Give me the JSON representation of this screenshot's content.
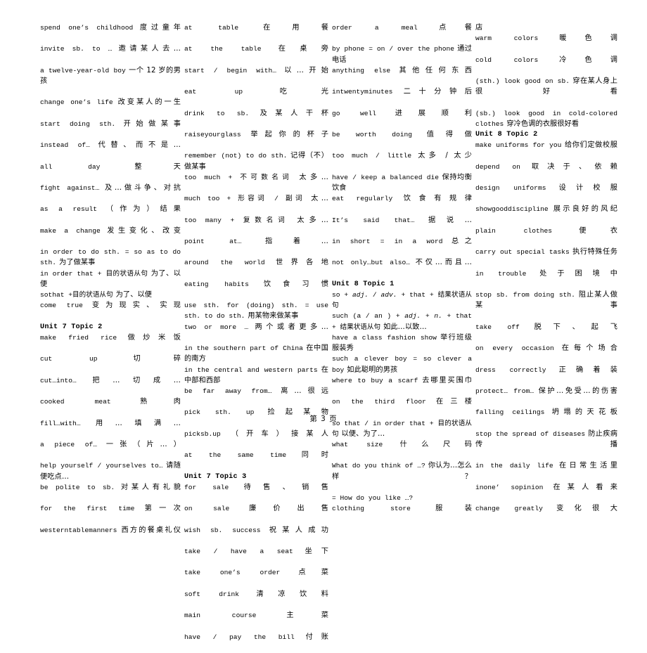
{
  "page": {
    "footer": "第 3 页"
  },
  "columns": [
    {
      "id": "column-1",
      "entries": [
        {
          "type": "pair",
          "en": "spend one’s childhood",
          "zh": "度过童年"
        },
        {
          "type": "pair",
          "en": "invite sb. to …",
          "zh": "邀请某人去…"
        },
        {
          "type": "pair",
          "en": "a twelve-year-old boy",
          "zh": "一个 12 岁的男孩"
        },
        {
          "type": "pair",
          "en": "change one’s life",
          "zh": "改变某人的一生"
        },
        {
          "type": "pair",
          "en": "start doing sth.",
          "zh": "开始做某事"
        },
        {
          "type": "pair",
          "en": "instead of…",
          "zh": "代替、而不是…"
        },
        {
          "type": "pair",
          "en": "all day",
          "zh": "整天"
        },
        {
          "type": "pair",
          "en": "fight against…",
          "zh": "及…做斗争、对抗"
        },
        {
          "type": "pair",
          "en": "as a result",
          "zh": "（作为）结果"
        },
        {
          "type": "pair",
          "en": "make a change",
          "zh": "发生变化、改变"
        },
        {
          "type": "flow",
          "en": "in order to do sth. = so as to do sth.",
          "zh": "为了做某事"
        },
        {
          "type": "flow",
          "en": "in order that + 目的状语从句",
          "zh": "为了、以便"
        },
        {
          "type": "flow",
          "en": "sothat  +目的状语从句",
          "zh": "为了、以便"
        },
        {
          "type": "pair",
          "en": "come true",
          "zh": "变为现实、实现"
        },
        {
          "type": "heading",
          "text": "Unit 7 Topic 2"
        },
        {
          "type": "pair",
          "en": "make fried rice",
          "zh": "做炒米饭"
        },
        {
          "type": "pair",
          "en": "cut up",
          "zh": "切碎"
        },
        {
          "type": "pair",
          "en": "cut…into…",
          "zh": "把…切成…"
        },
        {
          "type": "pair",
          "en": "cooked meat",
          "zh": "熟肉"
        },
        {
          "type": "pair",
          "en": "fill…with…",
          "zh": "用…填满…"
        },
        {
          "type": "pair",
          "en": "a piece of…",
          "zh": "一张（片…）"
        },
        {
          "type": "flow",
          "en": "help yourself / yourselves to…",
          "zh": "请随便吃点…"
        },
        {
          "type": "pair",
          "en": "be polite to sb.",
          "zh": "对某人有礼貌"
        },
        {
          "type": "pair",
          "en": "for the first time",
          "zh": "第一次"
        },
        {
          "type": "pair",
          "en": "westerntablemanners",
          "zh": "西方的餐桌礼仪"
        }
      ]
    },
    {
      "id": "column-2",
      "entries": [
        {
          "type": "pair",
          "en": "at table",
          "zh": "在用餐"
        },
        {
          "type": "pair",
          "en": "at the table",
          "zh": "在桌旁"
        },
        {
          "type": "pair",
          "en": "start / begin with…",
          "zh": "以…开始"
        },
        {
          "type": "pair",
          "en": "eat up",
          "zh": "吃光"
        },
        {
          "type": "pair",
          "en": "drink to sb.",
          "zh": "及某人干杯"
        },
        {
          "type": "pair",
          "en": "raiseyourglass",
          "zh": "举起你的杯子"
        },
        {
          "type": "flow",
          "en": "remember (not) to do sth.",
          "zh": "记得（不）做某事"
        },
        {
          "type": "pair",
          "en": "too much + 不可数名词",
          "zh": "太多…"
        },
        {
          "type": "pair",
          "en": "much too + 形容词 / 副词",
          "zh": "太…"
        },
        {
          "type": "pair",
          "en": "too many + 复数名词",
          "zh": "太多…"
        },
        {
          "type": "pair",
          "en": "point at…",
          "zh": "指着…"
        },
        {
          "type": "pair",
          "en": "around the world",
          "zh": "世界各地"
        },
        {
          "type": "pair",
          "en": "eating habits",
          "zh": "饮食习惯"
        },
        {
          "type": "flow",
          "en": "use sth. for (doing) sth. = use sth. to do sth.",
          "zh": "用某物来做某事"
        },
        {
          "type": "pair",
          "en": "two or more …",
          "zh": "两个或者更多…"
        },
        {
          "type": "flow",
          "en": "in the southern part of China",
          "zh": "在中国的南方"
        },
        {
          "type": "flow",
          "en": "in the central and western parts",
          "zh": "在中部和西部"
        },
        {
          "type": "pair",
          "en": "be far away from…",
          "zh": "离…很远"
        },
        {
          "type": "pair",
          "en": "pick sth. up",
          "zh": "捡起某物"
        },
        {
          "type": "pair",
          "en": "picksb.up",
          "zh": "（开车）接某人"
        },
        {
          "type": "pair",
          "en": "at the same time",
          "zh": "同时"
        },
        {
          "type": "heading",
          "text": "Unit 7 Topic 3"
        },
        {
          "type": "pair",
          "en": "for sale",
          "zh": "待售、销售"
        },
        {
          "type": "pair",
          "en": "on sale",
          "zh": "廉价出售"
        },
        {
          "type": "pair",
          "en": "wish sb. success",
          "zh": "祝某人成功"
        },
        {
          "type": "pair",
          "en": "take / have a seat",
          "zh": "坐下"
        },
        {
          "type": "pair",
          "en": "take one’s order",
          "zh": "点菜"
        },
        {
          "type": "pair",
          "en": "soft drink",
          "zh": "清凉饮料"
        },
        {
          "type": "pair",
          "en": "main course",
          "zh": "主菜"
        },
        {
          "type": "pair",
          "en": "have / pay the bill",
          "zh": "付账"
        }
      ]
    },
    {
      "id": "column-3",
      "entries": [
        {
          "type": "pair",
          "en": "order a meal",
          "zh": "点餐"
        },
        {
          "type": "flow",
          "en": "by phone = on / over the phone",
          "zh": "通过电话"
        },
        {
          "type": "pair",
          "en": "anything else",
          "zh": "其他任何东西"
        },
        {
          "type": "pair",
          "en": "intwentyminutes",
          "zh": "二十分钟后"
        },
        {
          "type": "pair",
          "en": "go well",
          "zh": "进展顺利"
        },
        {
          "type": "pair",
          "en": "be worth doing",
          "zh": "值得做"
        },
        {
          "type": "pair",
          "en": "too much / little",
          "zh": "太多 / 太少"
        },
        {
          "type": "flow",
          "en": "have / keep a balanced die",
          "zh": "保持均衡饮食"
        },
        {
          "type": "pair",
          "en": "eat regularly",
          "zh": "饮食有规律"
        },
        {
          "type": "pair",
          "en": "It’s said that…",
          "zh": "据说…"
        },
        {
          "type": "pair",
          "en": "in short = in a word",
          "zh": "总之"
        },
        {
          "type": "pair",
          "en": "not only…but also…",
          "zh": "不仅…而且…"
        },
        {
          "type": "heading",
          "text": "Unit 8 Topic 1"
        },
        {
          "type": "flow",
          "en_html": "so + <i>adj.</i> / <i>adv.</i> + that + 结果状语从句",
          "zh": ""
        },
        {
          "type": "flow",
          "en_html": "such (a / an ) + <i>adj.</i> + <i>n.</i> + that + 结果状语从句",
          "zh": "如此…以致…"
        },
        {
          "type": "flow",
          "en": "have a class fashion show",
          "zh": "举行班级服装秀"
        },
        {
          "type": "flow",
          "en": "such a clever boy = so clever a boy",
          "zh": "如此聪明的男孩"
        },
        {
          "type": "pair",
          "en": "where to buy a scarf",
          "zh": "去哪里买围巾"
        },
        {
          "type": "pair",
          "en": "on the third floor",
          "zh": "在三楼"
        },
        {
          "type": "flow",
          "en": "so that / in order that + 目的状语从句",
          "zh": "以便、为了…"
        },
        {
          "type": "pair",
          "en": "what size",
          "zh": "什么尺码"
        },
        {
          "type": "pair",
          "en": "What do you think of …?",
          "zh": "你认为…怎么样？"
        },
        {
          "type": "fullen",
          "en": "= How do you like …?"
        },
        {
          "type": "pair",
          "en": "clothing store",
          "zh": "服装"
        }
      ]
    },
    {
      "id": "column-4",
      "entries": [
        {
          "type": "wrapzh",
          "zh": "店"
        },
        {
          "type": "pair",
          "en": "warm colors",
          "zh": "暖色调"
        },
        {
          "type": "pair",
          "en": "cold colors",
          "zh": "冷色调"
        },
        {
          "type": "pair",
          "en": "(sth.) look good on sb.",
          "zh": "穿在某人身上很好看"
        },
        {
          "type": "flow",
          "en": "(sb.) look good in cold-colored clothes",
          "zh": "穿冷色调的衣服很好看"
        },
        {
          "type": "heading",
          "text": "Unit 8 Topic 2"
        },
        {
          "type": "pair",
          "en": "make uniforms for you",
          "zh": "给你们定做校服"
        },
        {
          "type": "pair",
          "en": "depend on",
          "zh": "取决于、依赖"
        },
        {
          "type": "pair",
          "en": "design uniforms",
          "zh": "设计校服"
        },
        {
          "type": "pair",
          "en": "showgooddiscipline",
          "zh": "展示良好的风纪"
        },
        {
          "type": "pair",
          "en": "plain clothes",
          "zh": "便衣"
        },
        {
          "type": "pair",
          "en": "carry out special tasks",
          "zh": "执行特殊任务"
        },
        {
          "type": "pair",
          "en": "in trouble",
          "zh": "处于困境中"
        },
        {
          "type": "pair",
          "en": "stop sb. from doing sth.",
          "zh": "阻止某人做某事"
        },
        {
          "type": "pair",
          "en": "take off",
          "zh": "脱下、起飞"
        },
        {
          "type": "pair",
          "en": "on every occasion",
          "zh": "在每个场合"
        },
        {
          "type": "pair",
          "en": "dress correctly",
          "zh": "正确着装"
        },
        {
          "type": "pair",
          "en": "protect… from…",
          "zh": "保护…免受…的伤害"
        },
        {
          "type": "pair",
          "en": "falling ceilings",
          "zh": "坍塌的天花板"
        },
        {
          "type": "pair",
          "en": "stop the spread of diseases",
          "zh": "防止疾病传播"
        },
        {
          "type": "pair",
          "en": "in the daily life",
          "zh": "在日常生活里"
        },
        {
          "type": "pair",
          "en": "inone’ sopinion",
          "zh": "在某人看来"
        },
        {
          "type": "pair",
          "en": "change greatly",
          "zh": "变化很大"
        }
      ]
    }
  ]
}
